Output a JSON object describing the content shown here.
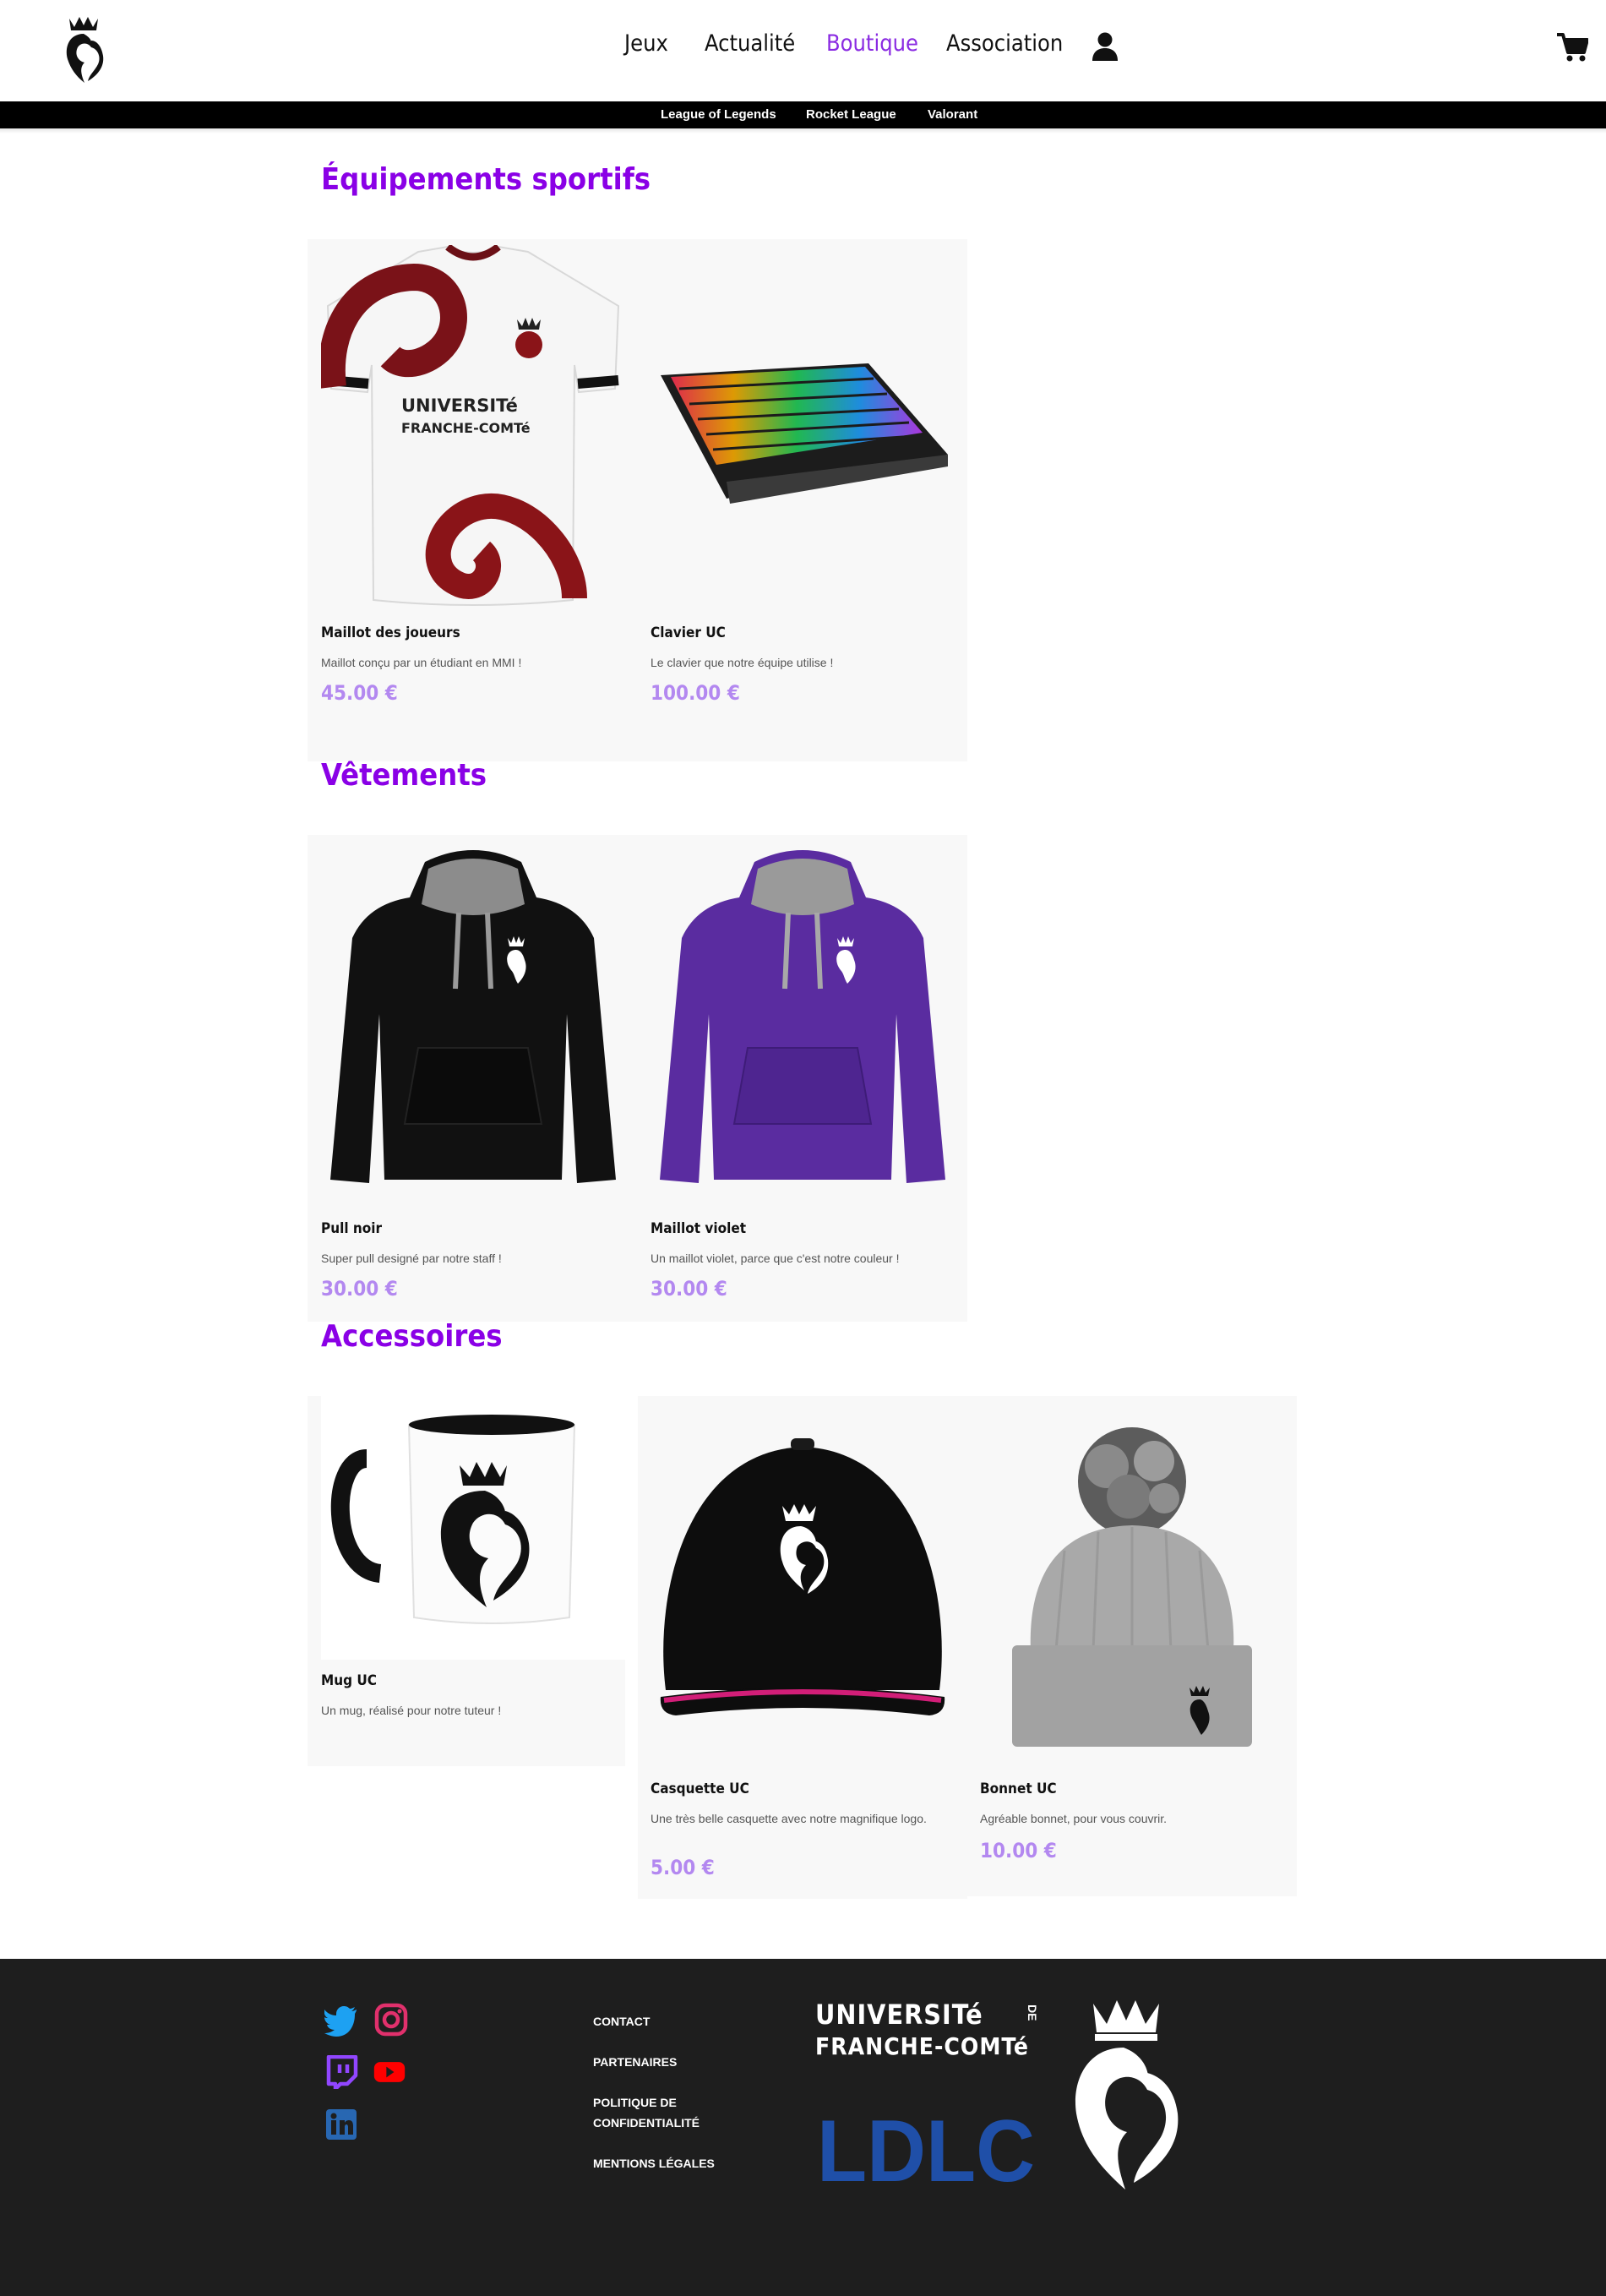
{
  "header": {
    "logo_name": "lion-crown-logo",
    "nav": [
      {
        "label": "Jeux",
        "active": false
      },
      {
        "label": "Actualité",
        "active": false
      },
      {
        "label": "Boutique",
        "active": true
      },
      {
        "label": "Association",
        "active": false
      }
    ],
    "user_icon": "user-icon",
    "cart_icon": "cart-icon",
    "subnav": [
      "League of Legends",
      "Rocket League",
      "Valorant"
    ]
  },
  "sections": [
    {
      "title": "Équipements sportifs",
      "products": [
        {
          "name": "Maillot des joueurs",
          "desc": "Maillot conçu par un étudiant en MMI !",
          "price": "45.00 €",
          "image": "jersey"
        },
        {
          "name": "Clavier UC",
          "desc": "Le clavier que notre équipe utilise !",
          "price": "100.00 €",
          "image": "keyboard"
        }
      ]
    },
    {
      "title": "Vêtements",
      "products": [
        {
          "name": "Pull noir",
          "desc": "Super pull designé par notre staff !",
          "price": "30.00 €",
          "image": "black-hoodie"
        },
        {
          "name": "Maillot violet",
          "desc": "Un maillot violet, parce que c'est notre couleur !",
          "price": "30.00 €",
          "image": "purple-hoodie"
        }
      ]
    },
    {
      "title": "Accessoires",
      "products": [
        {
          "name": "Mug UC",
          "desc": "Un mug, réalisé pour notre tuteur !",
          "price": "",
          "image": "mug"
        },
        {
          "name": "Casquette UC",
          "desc": "Une très belle casquette avec notre magnifique logo.",
          "price": "5.00 €",
          "image": "cap"
        },
        {
          "name": "Bonnet UC",
          "desc": "Agréable bonnet, pour vous couvrir.",
          "price": "10.00 €",
          "image": "beanie"
        }
      ]
    }
  ],
  "footer": {
    "social": [
      "twitter-icon",
      "instagram-icon",
      "twitch-icon",
      "youtube-icon",
      "linkedin-icon"
    ],
    "links": {
      "contact": "CONTACT",
      "partenaires": "PARTENAIRES",
      "politique": "POLITIQUE DE CONFIDENTIALITÉ",
      "mentions": "MENTIONS LÉGALES"
    },
    "partner_text": {
      "line1": "UNIVERSITé",
      "line2": "FRANCHE-COMTé",
      "de": "DE"
    },
    "sponsor": "LDLC"
  },
  "colors": {
    "accent": "#8a00e6",
    "price": "#b388f0",
    "footer_bg": "#1e1e1e"
  }
}
